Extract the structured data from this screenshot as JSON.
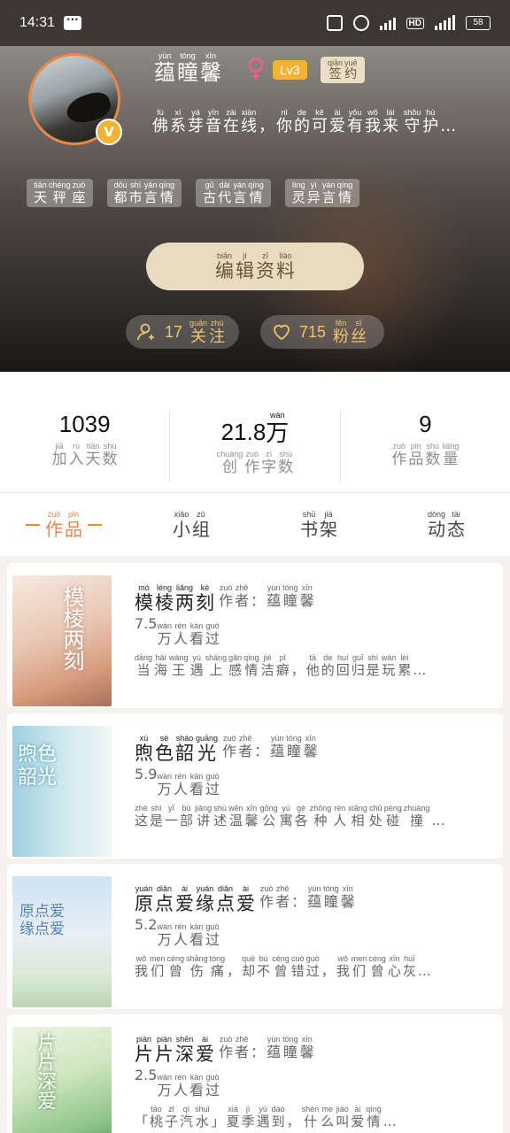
{
  "status_bar": {
    "time": "14:31",
    "battery": "58"
  },
  "profile": {
    "username": [
      [
        "yùn",
        "蕴"
      ],
      [
        "tóng",
        "瞳"
      ],
      [
        "xīn",
        "馨"
      ]
    ],
    "gender_symbol": "♀",
    "level": "Lv3",
    "sign_label": [
      [
        "qiān",
        "签"
      ],
      [
        "yuē",
        "约"
      ]
    ],
    "vip_mark": "V",
    "bio_line1": [
      [
        "fú",
        "佛"
      ],
      [
        "xì",
        "系"
      ],
      [
        "yá",
        "芽"
      ],
      [
        "yīn",
        "音"
      ],
      [
        "zài",
        "在"
      ],
      [
        "xiàn",
        "线"
      ],
      [
        "",
        "，"
      ],
      [
        "nǐ",
        "你"
      ],
      [
        "de",
        "的"
      ],
      [
        "kě",
        "可"
      ],
      [
        "ài",
        "爱"
      ],
      [
        "yǒu",
        "有"
      ],
      [
        "wǒ",
        "我"
      ],
      [
        "lái",
        "来"
      ]
    ],
    "bio_line2": [
      [
        "shǒu",
        "守"
      ],
      [
        "hù",
        "护"
      ],
      [
        "",
        "…"
      ]
    ],
    "tags": [
      [
        [
          "tiān",
          "天"
        ],
        [
          "chèng",
          "秤"
        ],
        [
          "zuò",
          "座"
        ]
      ],
      [
        [
          "dōu",
          "都"
        ],
        [
          "shì",
          "市"
        ],
        [
          "yán",
          "言"
        ],
        [
          "qíng",
          "情"
        ]
      ],
      [
        [
          "gǔ",
          "古"
        ],
        [
          "dài",
          "代"
        ],
        [
          "yán",
          "言"
        ],
        [
          "qíng",
          "情"
        ]
      ],
      [
        [
          "líng",
          "灵"
        ],
        [
          "yì",
          "异"
        ],
        [
          "yán",
          "言"
        ],
        [
          "qíng",
          "情"
        ]
      ]
    ],
    "edit_label": [
      [
        "biān",
        "编"
      ],
      [
        "jí",
        "辑"
      ],
      [
        "zī",
        "资"
      ],
      [
        "liào",
        "料"
      ]
    ],
    "following": {
      "count": "17",
      "label": [
        [
          "guān",
          "关"
        ],
        [
          "zhù",
          "注"
        ]
      ]
    },
    "fans": {
      "count": "715",
      "label": [
        [
          "fěn",
          "粉"
        ],
        [
          "sī",
          "丝"
        ]
      ]
    }
  },
  "stats": [
    {
      "value": "1039",
      "unit": [],
      "label": [
        [
          "jiā",
          "加"
        ],
        [
          "rù",
          "入"
        ],
        [
          "tiān",
          "天"
        ],
        [
          "shù",
          "数"
        ]
      ]
    },
    {
      "value": "21.8",
      "unit": [
        [
          "wàn",
          "万"
        ]
      ],
      "label": [
        [
          "chuàng",
          "创"
        ],
        [
          "zuò",
          "作"
        ],
        [
          "zì",
          "字"
        ],
        [
          "shù",
          "数"
        ]
      ]
    },
    {
      "value": "9",
      "unit": [],
      "label": [
        [
          "zuò",
          "作"
        ],
        [
          "pǐn",
          "品"
        ],
        [
          "shù",
          "数"
        ],
        [
          "liàng",
          "量"
        ]
      ]
    }
  ],
  "tabs": [
    {
      "label": [
        [
          "zuò",
          "作"
        ],
        [
          "pǐn",
          "品"
        ]
      ],
      "active": true
    },
    {
      "label": [
        [
          "xiǎo",
          "小"
        ],
        [
          "zǔ",
          "组"
        ]
      ],
      "active": false
    },
    {
      "label": [
        [
          "shū",
          "书"
        ],
        [
          "jià",
          "架"
        ]
      ],
      "active": false
    },
    {
      "label": [
        [
          "dòng",
          "动"
        ],
        [
          "tài",
          "态"
        ]
      ],
      "active": false
    }
  ],
  "books": [
    {
      "cover_text": "模棱两刻",
      "title": [
        [
          "mó",
          "模"
        ],
        [
          "léng",
          "棱"
        ],
        [
          "liǎng",
          "两"
        ],
        [
          "kè",
          "刻"
        ]
      ],
      "author": [
        [
          "zuò",
          "作"
        ],
        [
          "zhě",
          "者"
        ],
        [
          "",
          "："
        ],
        [
          "yùn",
          "蕴"
        ],
        [
          "tóng",
          "瞳"
        ],
        [
          "xīn",
          "馨"
        ]
      ],
      "views_num": "7.5",
      "views": [
        [
          "wàn",
          "万"
        ],
        [
          "rén",
          "人"
        ],
        [
          "kàn",
          "看"
        ],
        [
          "guò",
          "过"
        ]
      ],
      "desc": [
        [
          "dāng",
          "当"
        ],
        [
          "hǎi",
          "海"
        ],
        [
          "wáng",
          "王"
        ],
        [
          "yù",
          "遇"
        ],
        [
          "shàng",
          "上"
        ],
        [
          "gǎn",
          "感"
        ],
        [
          "qíng",
          "情"
        ],
        [
          "jié",
          "洁"
        ],
        [
          "pǐ",
          "癖"
        ],
        [
          "",
          "，"
        ],
        [
          "tā",
          "他"
        ],
        [
          "de",
          "的"
        ],
        [
          "huí",
          "回"
        ],
        [
          "guī",
          "归"
        ],
        [
          "shì",
          "是"
        ],
        [
          "wán",
          "玩"
        ],
        [
          "lèi",
          "累"
        ],
        [
          "",
          "…"
        ]
      ]
    },
    {
      "cover_text": "煦色韶光",
      "title": [
        [
          "xù",
          "煦"
        ],
        [
          "sè",
          "色"
        ],
        [
          "sháo",
          "韶"
        ],
        [
          "guāng",
          "光"
        ]
      ],
      "author": [
        [
          "zuò",
          "作"
        ],
        [
          "zhě",
          "者"
        ],
        [
          "",
          "："
        ],
        [
          "yùn",
          "蕴"
        ],
        [
          "tóng",
          "瞳"
        ],
        [
          "xīn",
          "馨"
        ]
      ],
      "views_num": "5.9",
      "views": [
        [
          "wàn",
          "万"
        ],
        [
          "rén",
          "人"
        ],
        [
          "kàn",
          "看"
        ],
        [
          "guò",
          "过"
        ]
      ],
      "desc": [
        [
          "zhè",
          "这"
        ],
        [
          "shì",
          "是"
        ],
        [
          "yī",
          "一"
        ],
        [
          "bù",
          "部"
        ],
        [
          "jiǎng",
          "讲"
        ],
        [
          "shù",
          "述"
        ],
        [
          "wēn",
          "温"
        ],
        [
          "xīn",
          "馨"
        ],
        [
          "gōng",
          "公"
        ],
        [
          "yù",
          "寓"
        ],
        [
          "gè",
          "各"
        ],
        [
          "zhǒng",
          "种"
        ],
        [
          "rén",
          "人"
        ],
        [
          "xiāng",
          "相"
        ],
        [
          "chǔ",
          "处"
        ],
        [
          "pèng",
          "碰"
        ],
        [
          "zhuàng",
          "撞"
        ],
        [
          "",
          "…"
        ]
      ]
    },
    {
      "cover_text": "原点爱缘点爱",
      "title": [
        [
          "yuán",
          "原"
        ],
        [
          "diǎn",
          "点"
        ],
        [
          "ài",
          "爱"
        ],
        [
          "yuán",
          "缘"
        ],
        [
          "diǎn",
          "点"
        ],
        [
          "ài",
          "爱"
        ]
      ],
      "author": [
        [
          "zuò",
          "作"
        ],
        [
          "zhě",
          "者"
        ],
        [
          "",
          "："
        ],
        [
          "yùn",
          "蕴"
        ],
        [
          "tóng",
          "瞳"
        ],
        [
          "xīn",
          "馨"
        ]
      ],
      "views_num": "5.2",
      "views": [
        [
          "wàn",
          "万"
        ],
        [
          "rén",
          "人"
        ],
        [
          "kàn",
          "看"
        ],
        [
          "guò",
          "过"
        ]
      ],
      "desc": [
        [
          "wǒ",
          "我"
        ],
        [
          "men",
          "们"
        ],
        [
          "céng",
          "曾"
        ],
        [
          "shāng",
          "伤"
        ],
        [
          "tòng",
          "痛"
        ],
        [
          "",
          "，"
        ],
        [
          "què",
          "却"
        ],
        [
          "bù",
          "不"
        ],
        [
          "céng",
          "曾"
        ],
        [
          "cuò",
          "错"
        ],
        [
          "guò",
          "过"
        ],
        [
          "",
          "，"
        ],
        [
          "wǒ",
          "我"
        ],
        [
          "men",
          "们"
        ],
        [
          "céng",
          "曾"
        ],
        [
          "xīn",
          "心"
        ],
        [
          "huī",
          "灰"
        ],
        [
          "",
          "…"
        ]
      ]
    },
    {
      "cover_text": "片片深爱",
      "title": [
        [
          "piàn",
          "片"
        ],
        [
          "piàn",
          "片"
        ],
        [
          "shēn",
          "深"
        ],
        [
          "ài",
          "爱"
        ]
      ],
      "author": [
        [
          "zuò",
          "作"
        ],
        [
          "zhě",
          "者"
        ],
        [
          "",
          "："
        ],
        [
          "yùn",
          "蕴"
        ],
        [
          "tóng",
          "瞳"
        ],
        [
          "xīn",
          "馨"
        ]
      ],
      "views_num": "2.5",
      "views": [
        [
          "wàn",
          "万"
        ],
        [
          "rén",
          "人"
        ],
        [
          "kàn",
          "看"
        ],
        [
          "guò",
          "过"
        ]
      ],
      "desc": [
        [
          "",
          "「"
        ],
        [
          "táo",
          "桃"
        ],
        [
          "zǐ",
          "子"
        ],
        [
          "qì",
          "汽"
        ],
        [
          "shuǐ",
          "水"
        ],
        [
          "",
          "」"
        ],
        [
          "xià",
          "夏"
        ],
        [
          "jì",
          "季"
        ],
        [
          "yù",
          "遇"
        ],
        [
          "dào",
          "到"
        ],
        [
          "",
          "，"
        ],
        [
          "shén",
          "什"
        ],
        [
          "me",
          "么"
        ],
        [
          "jiào",
          "叫"
        ],
        [
          "ài",
          "爱"
        ],
        [
          "qíng",
          "情"
        ],
        [
          "",
          "…"
        ]
      ]
    }
  ],
  "colors": {
    "accent": "#e8874c",
    "gold": "#f2c36b",
    "level": "#f3b235",
    "gender": "#ee5d8f"
  }
}
